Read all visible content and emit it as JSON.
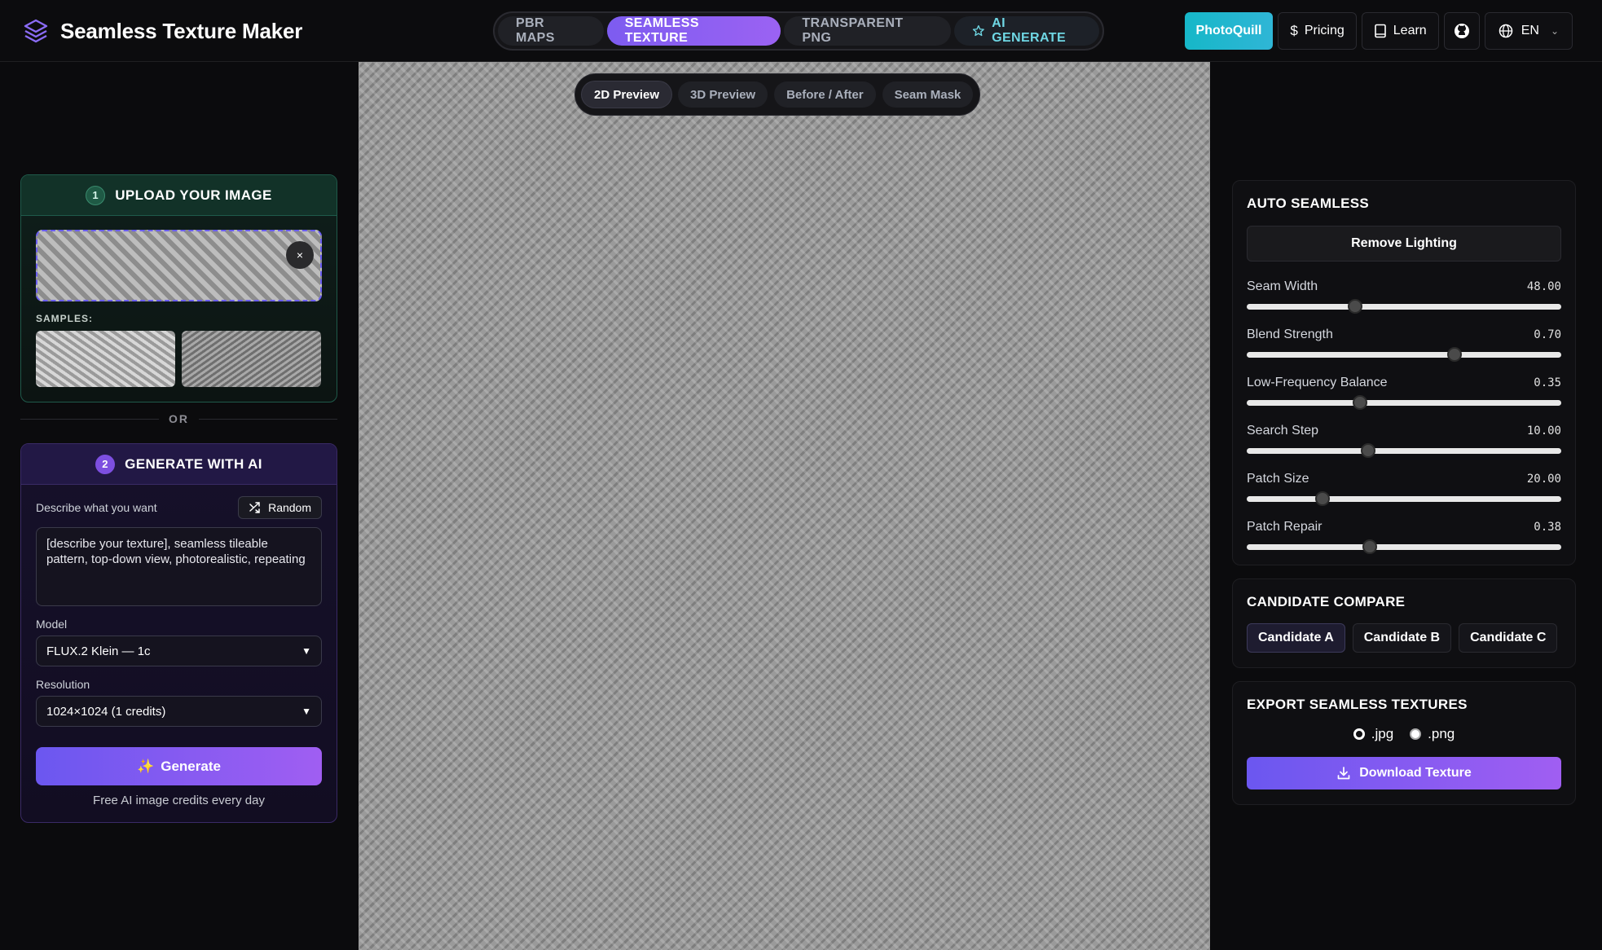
{
  "app": {
    "title": "Seamless Texture Maker"
  },
  "nav": {
    "tabs": [
      {
        "label": "PBR MAPS"
      },
      {
        "label": "SEAMLESS TEXTURE"
      },
      {
        "label": "TRANSPARENT PNG"
      },
      {
        "label": "AI GENERATE"
      }
    ],
    "photoquill": "PhotoQuill",
    "pricing": "Pricing",
    "learn": "Learn",
    "lang": "EN"
  },
  "upload": {
    "step": "1",
    "title": "UPLOAD YOUR IMAGE",
    "close": "×",
    "samples_label": "SAMPLES:"
  },
  "or_text": "OR",
  "generate": {
    "step": "2",
    "title": "GENERATE WITH AI",
    "describe_label": "Describe what you want",
    "random_label": "Random",
    "prompt": "[describe your texture], seamless tileable pattern, top-down view, photorealistic, repeating",
    "model_label": "Model",
    "model_value": "FLUX.2 Klein — 1c",
    "resolution_label": "Resolution",
    "resolution_value": "1024×1024 (1 credits)",
    "button": "Generate",
    "credits_note": "Free AI image credits every day"
  },
  "preview_tabs": [
    {
      "label": "2D Preview"
    },
    {
      "label": "3D Preview"
    },
    {
      "label": "Before / After"
    },
    {
      "label": "Seam Mask"
    }
  ],
  "auto": {
    "title": "AUTO SEAMLESS",
    "remove": "Remove Lighting",
    "sliders": [
      {
        "label": "Seam Width",
        "value": "48.00",
        "level": 0.345
      },
      {
        "label": "Blend Strength",
        "value": "0.70",
        "level": 0.66
      },
      {
        "label": "Low-Frequency Balance",
        "value": "0.35",
        "level": 0.36
      },
      {
        "label": "Search Step",
        "value": "10.00",
        "level": 0.385
      },
      {
        "label": "Patch Size",
        "value": "20.00",
        "level": 0.24
      },
      {
        "label": "Patch Repair",
        "value": "0.38",
        "level": 0.39
      }
    ]
  },
  "compare": {
    "title": "CANDIDATE COMPARE",
    "candidates": [
      "Candidate A",
      "Candidate B",
      "Candidate C"
    ]
  },
  "export": {
    "title": "EXPORT SEAMLESS TEXTURES",
    "jpg": ".jpg",
    "png": ".png",
    "download": "Download Texture"
  }
}
